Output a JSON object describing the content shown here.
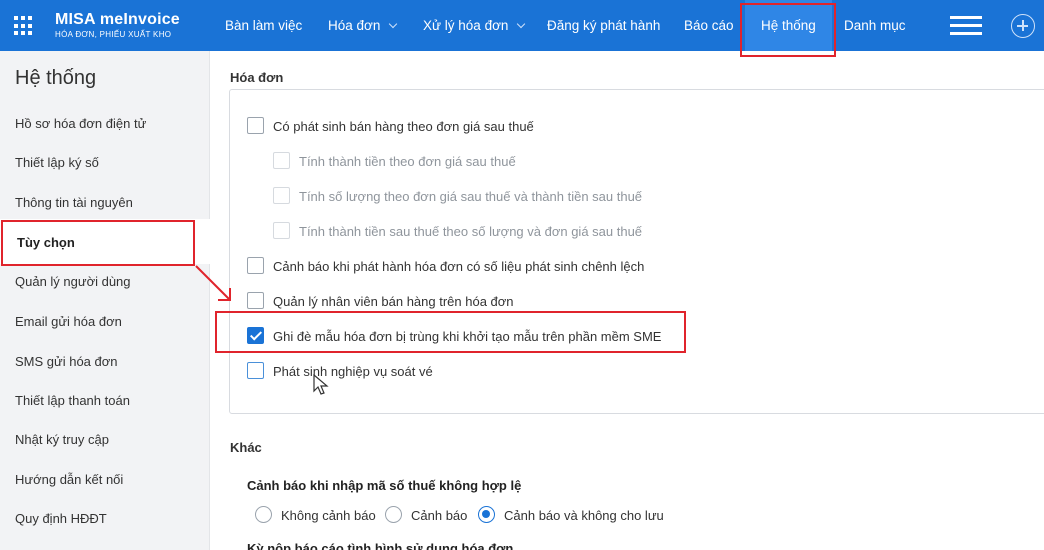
{
  "app": {
    "logo_main": "MISA meInvoice",
    "logo_sub": "HÓA ĐƠN, PHIẾU XUẤT KHO"
  },
  "nav": {
    "items": [
      {
        "label": "Bàn làm việc"
      },
      {
        "label": "Hóa đơn"
      },
      {
        "label": "Xử lý hóa đơn"
      },
      {
        "label": "Đăng ký phát hành"
      },
      {
        "label": "Báo cáo"
      },
      {
        "label": "Hệ thống"
      },
      {
        "label": "Danh mục"
      }
    ],
    "active": "Hệ thống"
  },
  "sidebar": {
    "title": "Hệ thống",
    "items": [
      {
        "label": "Hồ sơ hóa đơn điện tử"
      },
      {
        "label": "Thiết lập ký số"
      },
      {
        "label": "Thông tin tài nguyên"
      },
      {
        "label": "Tùy chọn"
      },
      {
        "label": "Quản lý người dùng"
      },
      {
        "label": "Email gửi hóa đơn"
      },
      {
        "label": "SMS gửi hóa đơn"
      },
      {
        "label": "Thiết lập thanh toán"
      },
      {
        "label": "Nhật ký truy cập"
      },
      {
        "label": "Hướng dẫn kết nối"
      },
      {
        "label": "Quy định HĐĐT"
      }
    ],
    "active": "Tùy chọn"
  },
  "invoice_section": {
    "title": "Hóa đơn",
    "options": [
      {
        "label": "Có phát sinh bán hàng theo đơn giá sau thuế",
        "checked": false,
        "enabled": true
      },
      {
        "label": "Tính thành tiền theo đơn giá sau thuế",
        "checked": false,
        "enabled": false
      },
      {
        "label": "Tính số lượng theo đơn giá sau thuế và thành tiền sau thuế",
        "checked": false,
        "enabled": false
      },
      {
        "label": "Tính thành tiền sau thuế theo số lượng và đơn giá sau thuế",
        "checked": false,
        "enabled": false
      },
      {
        "label": "Cảnh báo khi phát hành hóa đơn có số liệu phát sinh chênh lệch",
        "checked": false,
        "enabled": true
      },
      {
        "label": "Quản lý nhân viên bán hàng trên hóa đơn",
        "checked": false,
        "enabled": true
      },
      {
        "label": "Ghi đè mẫu hóa đơn bị trùng khi khởi tạo mẫu trên phần mềm SME",
        "checked": true,
        "enabled": true
      },
      {
        "label": "Phát sinh nghiệp vụ soát vé",
        "checked": false,
        "enabled": true
      }
    ]
  },
  "other_section": {
    "title": "Khác",
    "tax_code_warning": {
      "title": "Cảnh báo khi nhập mã số thuế không hợp lệ",
      "options": [
        {
          "label": "Không cảnh báo",
          "selected": false
        },
        {
          "label": "Cảnh báo",
          "selected": false
        },
        {
          "label": "Cảnh báo và không cho lưu",
          "selected": true
        }
      ]
    },
    "next_title": "Kỳ nộp báo cáo tình hình sử dụng hóa đơn"
  },
  "colors": {
    "nav_bg": "#1a73d6",
    "nav_active": "#2f86e6",
    "highlight": "#e0242c",
    "sidebar_bg": "#f2f3f5",
    "check_blue": "#1a73d6"
  },
  "icons": [
    "apps-grid-icon",
    "chevron-down-icon",
    "hamburger-menu-icon",
    "add-circle-icon",
    "check-icon",
    "annotation-arrow-icon",
    "mouse-cursor-icon"
  ]
}
